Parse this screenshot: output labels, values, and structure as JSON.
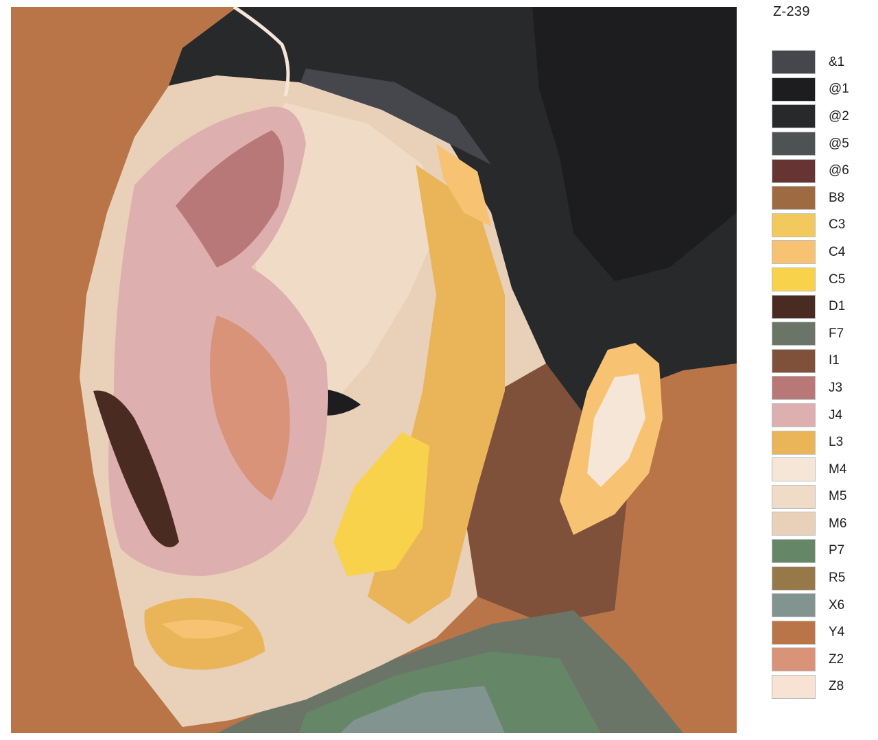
{
  "code": "Z-239",
  "palette": [
    {
      "code": "&1",
      "color": "#45474c"
    },
    {
      "code": "@1",
      "color": "#1d1d20"
    },
    {
      "code": "@2",
      "color": "#27292b"
    },
    {
      "code": "@5",
      "color": "#4e5253"
    },
    {
      "code": "@6",
      "color": "#663433"
    },
    {
      "code": "B8",
      "color": "#9e6a42"
    },
    {
      "code": "C3",
      "color": "#f2c95c"
    },
    {
      "code": "C4",
      "color": "#f7c372"
    },
    {
      "code": "C5",
      "color": "#f8d24b"
    },
    {
      "code": "D1",
      "color": "#4a2b21"
    },
    {
      "code": "F7",
      "color": "#6b7567"
    },
    {
      "code": "I1",
      "color": "#7f513b"
    },
    {
      "code": "J3",
      "color": "#b97878"
    },
    {
      "code": "J4",
      "color": "#ddafaf"
    },
    {
      "code": "L3",
      "color": "#eab458"
    },
    {
      "code": "M4",
      "color": "#f6e6d8"
    },
    {
      "code": "M5",
      "color": "#f0dcc6"
    },
    {
      "code": "M6",
      "color": "#e9d0b8"
    },
    {
      "code": "P7",
      "color": "#668668"
    },
    {
      "code": "R5",
      "color": "#977849"
    },
    {
      "code": "X6",
      "color": "#829490"
    },
    {
      "code": "Y4",
      "color": "#b97548"
    },
    {
      "code": "Z2",
      "color": "#d89379"
    },
    {
      "code": "Z8",
      "color": "#f8e2d4"
    }
  ]
}
